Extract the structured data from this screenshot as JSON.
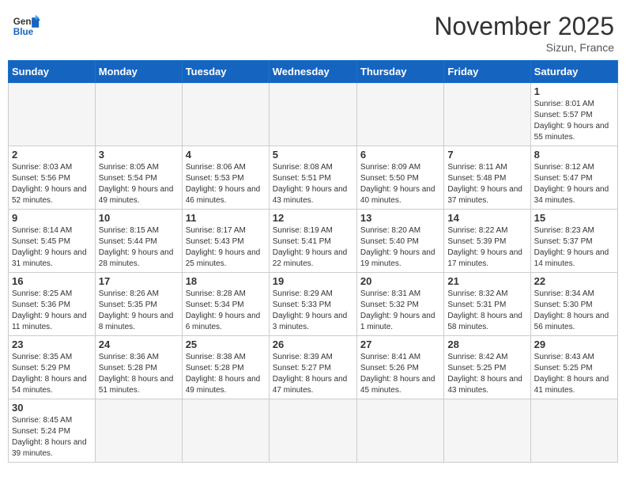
{
  "header": {
    "logo_general": "General",
    "logo_blue": "Blue",
    "month_title": "November 2025",
    "location": "Sizun, France"
  },
  "weekdays": [
    "Sunday",
    "Monday",
    "Tuesday",
    "Wednesday",
    "Thursday",
    "Friday",
    "Saturday"
  ],
  "weeks": [
    [
      {
        "day": "",
        "info": ""
      },
      {
        "day": "",
        "info": ""
      },
      {
        "day": "",
        "info": ""
      },
      {
        "day": "",
        "info": ""
      },
      {
        "day": "",
        "info": ""
      },
      {
        "day": "",
        "info": ""
      },
      {
        "day": "1",
        "info": "Sunrise: 8:01 AM\nSunset: 5:57 PM\nDaylight: 9 hours and 55 minutes."
      }
    ],
    [
      {
        "day": "2",
        "info": "Sunrise: 8:03 AM\nSunset: 5:56 PM\nDaylight: 9 hours and 52 minutes."
      },
      {
        "day": "3",
        "info": "Sunrise: 8:05 AM\nSunset: 5:54 PM\nDaylight: 9 hours and 49 minutes."
      },
      {
        "day": "4",
        "info": "Sunrise: 8:06 AM\nSunset: 5:53 PM\nDaylight: 9 hours and 46 minutes."
      },
      {
        "day": "5",
        "info": "Sunrise: 8:08 AM\nSunset: 5:51 PM\nDaylight: 9 hours and 43 minutes."
      },
      {
        "day": "6",
        "info": "Sunrise: 8:09 AM\nSunset: 5:50 PM\nDaylight: 9 hours and 40 minutes."
      },
      {
        "day": "7",
        "info": "Sunrise: 8:11 AM\nSunset: 5:48 PM\nDaylight: 9 hours and 37 minutes."
      },
      {
        "day": "8",
        "info": "Sunrise: 8:12 AM\nSunset: 5:47 PM\nDaylight: 9 hours and 34 minutes."
      }
    ],
    [
      {
        "day": "9",
        "info": "Sunrise: 8:14 AM\nSunset: 5:45 PM\nDaylight: 9 hours and 31 minutes."
      },
      {
        "day": "10",
        "info": "Sunrise: 8:15 AM\nSunset: 5:44 PM\nDaylight: 9 hours and 28 minutes."
      },
      {
        "day": "11",
        "info": "Sunrise: 8:17 AM\nSunset: 5:43 PM\nDaylight: 9 hours and 25 minutes."
      },
      {
        "day": "12",
        "info": "Sunrise: 8:19 AM\nSunset: 5:41 PM\nDaylight: 9 hours and 22 minutes."
      },
      {
        "day": "13",
        "info": "Sunrise: 8:20 AM\nSunset: 5:40 PM\nDaylight: 9 hours and 19 minutes."
      },
      {
        "day": "14",
        "info": "Sunrise: 8:22 AM\nSunset: 5:39 PM\nDaylight: 9 hours and 17 minutes."
      },
      {
        "day": "15",
        "info": "Sunrise: 8:23 AM\nSunset: 5:37 PM\nDaylight: 9 hours and 14 minutes."
      }
    ],
    [
      {
        "day": "16",
        "info": "Sunrise: 8:25 AM\nSunset: 5:36 PM\nDaylight: 9 hours and 11 minutes."
      },
      {
        "day": "17",
        "info": "Sunrise: 8:26 AM\nSunset: 5:35 PM\nDaylight: 9 hours and 8 minutes."
      },
      {
        "day": "18",
        "info": "Sunrise: 8:28 AM\nSunset: 5:34 PM\nDaylight: 9 hours and 6 minutes."
      },
      {
        "day": "19",
        "info": "Sunrise: 8:29 AM\nSunset: 5:33 PM\nDaylight: 9 hours and 3 minutes."
      },
      {
        "day": "20",
        "info": "Sunrise: 8:31 AM\nSunset: 5:32 PM\nDaylight: 9 hours and 1 minute."
      },
      {
        "day": "21",
        "info": "Sunrise: 8:32 AM\nSunset: 5:31 PM\nDaylight: 8 hours and 58 minutes."
      },
      {
        "day": "22",
        "info": "Sunrise: 8:34 AM\nSunset: 5:30 PM\nDaylight: 8 hours and 56 minutes."
      }
    ],
    [
      {
        "day": "23",
        "info": "Sunrise: 8:35 AM\nSunset: 5:29 PM\nDaylight: 8 hours and 54 minutes."
      },
      {
        "day": "24",
        "info": "Sunrise: 8:36 AM\nSunset: 5:28 PM\nDaylight: 8 hours and 51 minutes."
      },
      {
        "day": "25",
        "info": "Sunrise: 8:38 AM\nSunset: 5:28 PM\nDaylight: 8 hours and 49 minutes."
      },
      {
        "day": "26",
        "info": "Sunrise: 8:39 AM\nSunset: 5:27 PM\nDaylight: 8 hours and 47 minutes."
      },
      {
        "day": "27",
        "info": "Sunrise: 8:41 AM\nSunset: 5:26 PM\nDaylight: 8 hours and 45 minutes."
      },
      {
        "day": "28",
        "info": "Sunrise: 8:42 AM\nSunset: 5:25 PM\nDaylight: 8 hours and 43 minutes."
      },
      {
        "day": "29",
        "info": "Sunrise: 8:43 AM\nSunset: 5:25 PM\nDaylight: 8 hours and 41 minutes."
      }
    ],
    [
      {
        "day": "30",
        "info": "Sunrise: 8:45 AM\nSunset: 5:24 PM\nDaylight: 8 hours and 39 minutes."
      },
      {
        "day": "",
        "info": ""
      },
      {
        "day": "",
        "info": ""
      },
      {
        "day": "",
        "info": ""
      },
      {
        "day": "",
        "info": ""
      },
      {
        "day": "",
        "info": ""
      },
      {
        "day": "",
        "info": ""
      }
    ]
  ]
}
